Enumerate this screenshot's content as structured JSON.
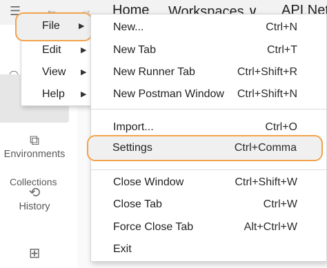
{
  "topbar": {
    "nav_home": "Home",
    "nav_workspaces": "Workspaces ∨",
    "nav_api": "API Net"
  },
  "sidebar": {
    "collections_label": "Collections",
    "environments_label": "Environments",
    "history_label": "History"
  },
  "file_menu": {
    "items": [
      {
        "label": "File"
      },
      {
        "label": "Edit"
      },
      {
        "label": "View"
      },
      {
        "label": "Help"
      }
    ]
  },
  "submenu": {
    "items": [
      {
        "label": "New...",
        "shortcut": "Ctrl+N"
      },
      {
        "label": "New Tab",
        "shortcut": "Ctrl+T"
      },
      {
        "label": "New Runner Tab",
        "shortcut": "Ctrl+Shift+R"
      },
      {
        "label": "New Postman Window",
        "shortcut": "Ctrl+Shift+N"
      },
      {
        "label": "Import...",
        "shortcut": "Ctrl+O"
      },
      {
        "label": "Settings",
        "shortcut": "Ctrl+Comma"
      },
      {
        "label": "Close Window",
        "shortcut": "Ctrl+Shift+W"
      },
      {
        "label": "Close Tab",
        "shortcut": "Ctrl+W"
      },
      {
        "label": "Force Close Tab",
        "shortcut": "Alt+Ctrl+W"
      },
      {
        "label": "Exit",
        "shortcut": ""
      }
    ]
  },
  "icons": {
    "hamburger": "hamburger-icon",
    "arrow": "chevron-right-icon"
  },
  "colors": {
    "highlight_outline": "#f2a24a"
  }
}
